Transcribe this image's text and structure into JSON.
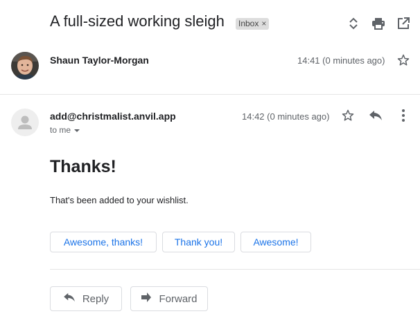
{
  "thread": {
    "subject": "A full-sized working sleigh",
    "label": "Inbox",
    "label_remove": "×"
  },
  "toolbar": {
    "icons": [
      "expand-collapse-icon",
      "print-icon",
      "open-in-new-window-icon"
    ]
  },
  "messages": [
    {
      "sender": "Shaun Taylor-Morgan",
      "time": "14:41 (0 minutes ago)",
      "avatar": "photo"
    },
    {
      "sender": "add@christmalist.anvil.app",
      "time": "14:42 (0 minutes ago)",
      "recipient_label": "to me",
      "avatar": "generic-person",
      "heading": "Thanks!",
      "body": "That's been added to your wishlist."
    }
  ],
  "smart_replies": [
    "Awesome, thanks!",
    "Thank you!",
    "Awesome!"
  ],
  "actions": {
    "reply": "Reply",
    "forward": "Forward"
  },
  "colors": {
    "link_blue": "#1a73e8",
    "icon_grey": "#5f6368",
    "divider": "#e5e5e5"
  }
}
